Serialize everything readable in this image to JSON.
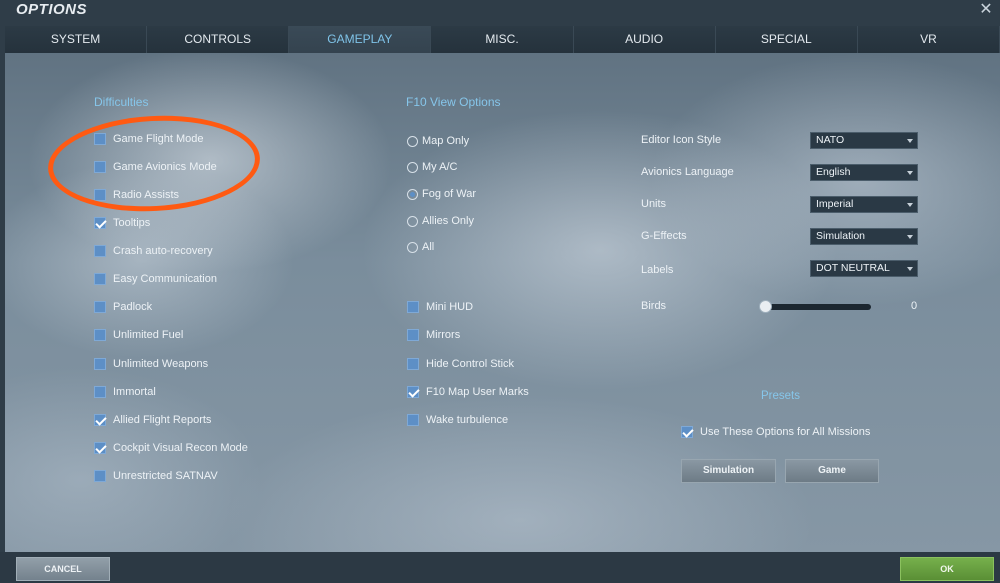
{
  "window": {
    "title": "OPTIONS"
  },
  "tabs": [
    {
      "label": "SYSTEM"
    },
    {
      "label": "CONTROLS"
    },
    {
      "label": "GAMEPLAY"
    },
    {
      "label": "MISC."
    },
    {
      "label": "AUDIO"
    },
    {
      "label": "SPECIAL"
    },
    {
      "label": "VR"
    }
  ],
  "active_tab": "GAMEPLAY",
  "difficulties": {
    "title": "Difficulties",
    "items": [
      {
        "label": "Game Flight Mode",
        "checked": false
      },
      {
        "label": "Game Avionics Mode",
        "checked": false
      },
      {
        "label": "Radio Assists",
        "checked": false
      },
      {
        "label": "Tooltips",
        "checked": true
      },
      {
        "label": "Crash auto-recovery",
        "checked": false
      },
      {
        "label": "Easy Communication",
        "checked": false
      },
      {
        "label": "Padlock",
        "checked": false
      },
      {
        "label": "Unlimited Fuel",
        "checked": false
      },
      {
        "label": "Unlimited Weapons",
        "checked": false
      },
      {
        "label": "Immortal",
        "checked": false
      },
      {
        "label": "Allied Flight Reports",
        "checked": true
      },
      {
        "label": "Cockpit Visual Recon Mode",
        "checked": true
      },
      {
        "label": "Unrestricted SATNAV",
        "checked": false
      }
    ]
  },
  "f10": {
    "title": "F10 View Options",
    "radios": [
      {
        "label": "Map Only",
        "checked": false
      },
      {
        "label": "My A/C",
        "checked": false
      },
      {
        "label": "Fog of War",
        "checked": true
      },
      {
        "label": "Allies Only",
        "checked": false
      },
      {
        "label": "All",
        "checked": false
      }
    ],
    "checks": [
      {
        "label": "Mini HUD",
        "checked": false
      },
      {
        "label": "Mirrors",
        "checked": false
      },
      {
        "label": "Hide Control Stick",
        "checked": false
      },
      {
        "label": "F10 Map User Marks",
        "checked": true
      },
      {
        "label": "Wake turbulence",
        "checked": false
      }
    ]
  },
  "settings": {
    "editor_icon_style": {
      "label": "Editor Icon Style",
      "value": "NATO"
    },
    "avionics_language": {
      "label": "Avionics Language",
      "value": "English"
    },
    "units": {
      "label": "Units",
      "value": "Imperial"
    },
    "g_effects": {
      "label": "G-Effects",
      "value": "Simulation"
    },
    "labels": {
      "label": "Labels",
      "value": "DOT NEUTRAL"
    },
    "birds": {
      "label": "Birds",
      "value": "0",
      "fraction": 0.0
    }
  },
  "presets": {
    "title": "Presets",
    "use_all": {
      "label": "Use These Options for All Missions",
      "checked": true
    },
    "simulation_label": "Simulation",
    "game_label": "Game"
  },
  "footer": {
    "cancel_label": "CANCEL",
    "ok_label": "OK"
  },
  "colors": {
    "accent": "#86c6ea",
    "checkbox": "#5d8fc6",
    "ok": "#6aa342",
    "annotation": "#ff5a12"
  }
}
